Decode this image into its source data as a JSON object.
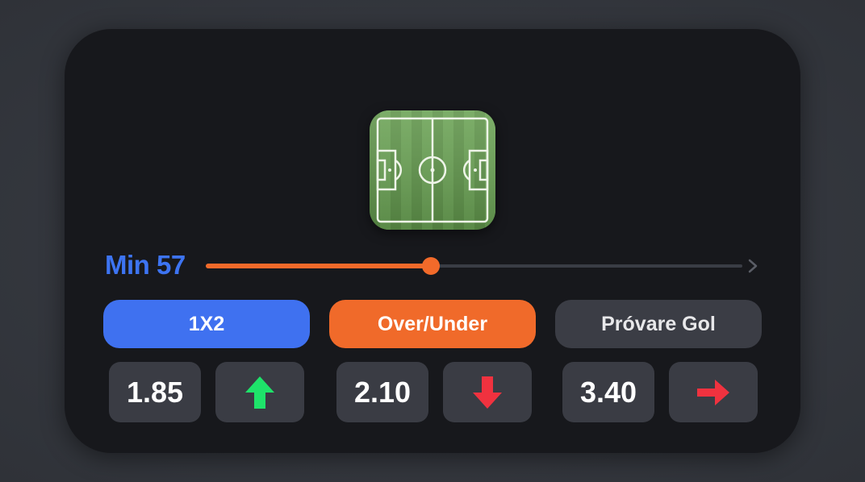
{
  "match": {
    "minute_label": "Min 57",
    "minute_progress": 0.42
  },
  "markets": [
    {
      "label": "1X2",
      "odd": "1.85",
      "trend": "up-arrow-icon",
      "color": "#3f71f0",
      "trend_color": "#1ee36a"
    },
    {
      "label": "Over/Under",
      "odd": "2.10",
      "trend": "down-arrow-icon",
      "color": "#f06a2a",
      "trend_color": "#f0323f"
    },
    {
      "label": "Próvare Gol",
      "odd": "3.40",
      "trend": "right-arrow-icon",
      "color": "#3b3d45",
      "trend_color": "#f0323f"
    }
  ],
  "colors": {
    "card_bg": "#17181c",
    "minute_text": "#3d74f2",
    "timeline_fill": "#f26a2a",
    "timeline_track": "#3a3d45"
  }
}
